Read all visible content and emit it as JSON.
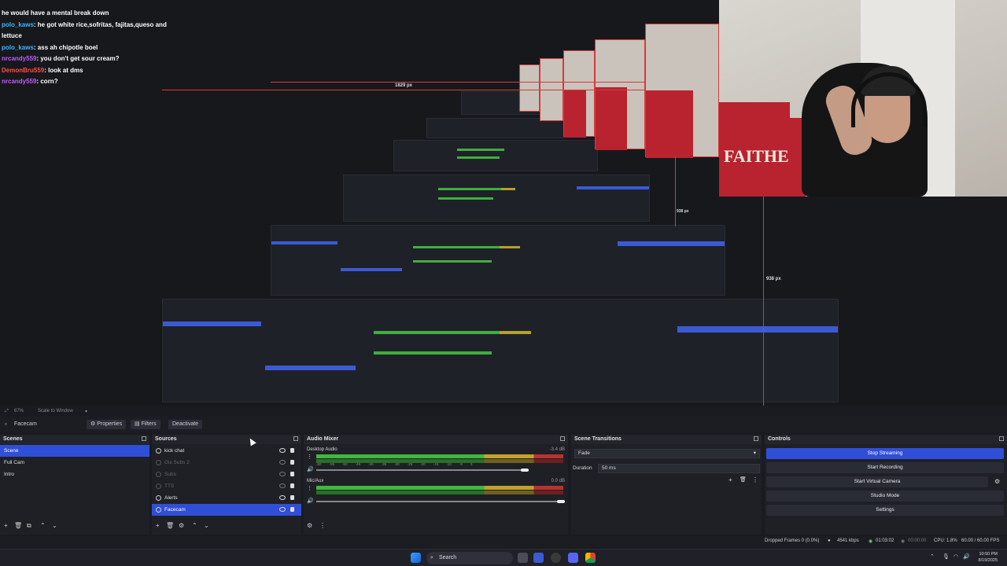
{
  "chat": {
    "lines": [
      {
        "user": "",
        "text": "he would have a mental break down"
      },
      {
        "user": "polo_kaws",
        "text": "he got white rice,sofritas, fajitas,queso and lettuce"
      },
      {
        "user": "polo_kaws",
        "text": "ass ah chipotle boel"
      },
      {
        "user": "nrcandy559",
        "text": "you don't get sour cream?"
      },
      {
        "user": "DemonBru559",
        "text": "look at dms"
      },
      {
        "user": "nrcandy559",
        "text": "corn?"
      }
    ]
  },
  "preview": {
    "measure_1": "1829 px",
    "measure_2": "938 px",
    "measure_3": "938 px",
    "webcam_jersey": "FAITHE"
  },
  "zoom": {
    "value": "67%",
    "mode": "Scale to Window"
  },
  "toolbar": {
    "selected_source": "Facecam",
    "properties": "Properties",
    "filters": "Filters",
    "deactivate": "Deactivate"
  },
  "scenes": {
    "title": "Scenes",
    "items": [
      "Scene",
      "Full Cam",
      "Intro"
    ]
  },
  "sources": {
    "title": "Sources",
    "items": [
      {
        "label": "kick chat",
        "dim": false
      },
      {
        "label": "Gix Subs 2",
        "dim": true
      },
      {
        "label": "Subs",
        "dim": true
      },
      {
        "label": "TTS",
        "dim": true
      },
      {
        "label": "Alerts",
        "dim": false
      },
      {
        "label": "Facecam",
        "dim": false
      }
    ]
  },
  "mixer": {
    "title": "Audio Mixer",
    "channels": [
      {
        "name": "Desktop Audio",
        "db": "-3.4 dB"
      },
      {
        "name": "Mic/Aux",
        "db": "0.0 dB"
      }
    ],
    "ticks": [
      "-60",
      "-55",
      "-50",
      "-45",
      "-40",
      "-35",
      "-30",
      "-25",
      "-20",
      "-15",
      "-10",
      "-5",
      "0"
    ]
  },
  "transitions": {
    "title": "Scene Transitions",
    "type": "Fade",
    "duration_label": "Duration",
    "duration_value": "50 ms"
  },
  "controls": {
    "title": "Controls",
    "buttons": [
      "Stop Streaming",
      "Start Recording",
      "Start Virtual Camera",
      "Studio Mode",
      "Settings"
    ]
  },
  "status": {
    "dropped": "Dropped Frames 0 (0.0%)",
    "kbps": "4541 kbps",
    "stream_time": "01:03:02",
    "rec_time": "00:00:00",
    "cpu": "CPU: 1.8%",
    "fps": "60.00 / 60.00 FPS"
  },
  "taskbar": {
    "search": "Search",
    "time": "10:50 PM",
    "date": "8/19/2025"
  },
  "colors": {
    "accent": "#2f4fd8",
    "stream_red": "#d63a3a"
  }
}
